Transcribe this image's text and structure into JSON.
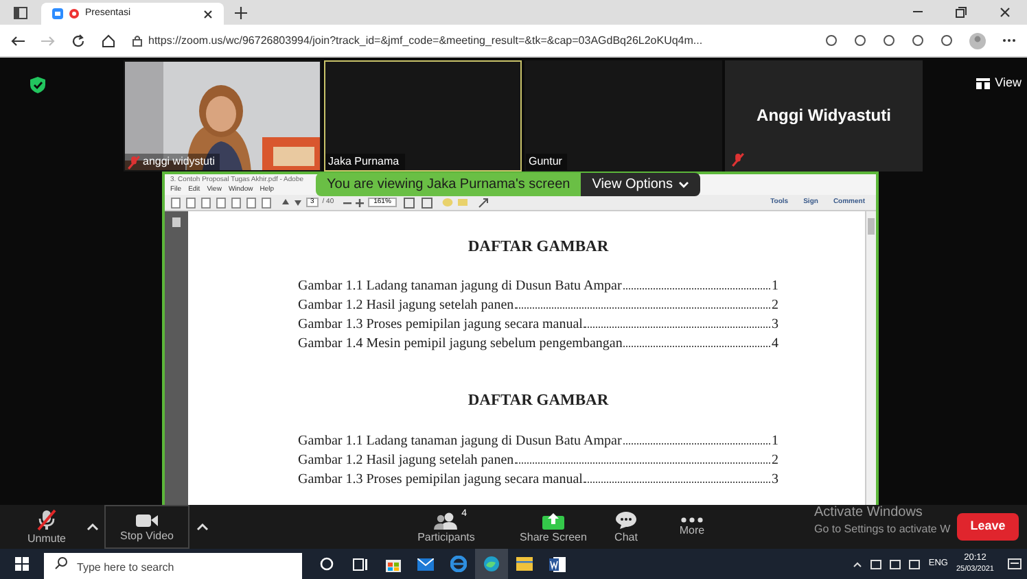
{
  "browser": {
    "tabs": [
      {
        "title": "Presentasi",
        "selected": true
      }
    ],
    "url": "https://zoom.us/wc/96726803994/join?track_id=&jmf_code=&meeting_result=&tk=&cap=03AGdBq26L2oKUq4m..."
  },
  "video_strip": {
    "tiles": [
      {
        "kind": "video",
        "name": "anggi widystuti",
        "muted": true,
        "active_speaker": false
      },
      {
        "kind": "blank",
        "name": "Jaka Purnama",
        "muted": false,
        "active_speaker": true
      },
      {
        "kind": "blank",
        "name": "Guntur",
        "muted": false,
        "active_speaker": false
      },
      {
        "kind": "name_card",
        "name": "Anggi Widyastuti",
        "muted": true,
        "active_speaker": false
      }
    ],
    "view_button": "View"
  },
  "share": {
    "banner": "You are viewing Jaka Purnama's screen",
    "view_options": "View Options",
    "reader": {
      "title": "3. Contoh Proposal Tugas Akhir.pdf - Adobe",
      "menu": [
        "File",
        "Edit",
        "View",
        "Window",
        "Help"
      ],
      "page_number": "3",
      "page_count": "/ 40",
      "zoom": "161%",
      "tool_links": [
        "Tools",
        "Sign",
        "Comment"
      ],
      "sections": [
        {
          "heading": "DAFTAR GAMBAR",
          "entries": [
            {
              "text": "Gambar 1.1 Ladang tanaman jagung di Dusun Batu Ampar",
              "page": "1"
            },
            {
              "text": "Gambar 1.2 Hasil jagung setelah panen",
              "page": "2"
            },
            {
              "text": "Gambar 1.3 Proses pemipilan jagung secara manual",
              "page": "3"
            },
            {
              "text": "Gambar 1.4 Mesin pemipil jagung sebelum pengembangan",
              "page": "4"
            }
          ]
        },
        {
          "heading": "DAFTAR GAMBAR",
          "entries": [
            {
              "text": "Gambar 1.1 Ladang tanaman jagung di Dusun Batu Ampar",
              "page": "1"
            },
            {
              "text": "Gambar 1.2 Hasil jagung setelah panen",
              "page": "2"
            },
            {
              "text": "Gambar 1.3 Proses pemipilan jagung secara manual",
              "page": "3"
            }
          ]
        }
      ]
    }
  },
  "windows_notice": {
    "title": "Activate Windows",
    "text": "Go to Settings to activate W"
  },
  "controls": {
    "items": [
      {
        "kind": "mic",
        "label": "Unmute",
        "muted": true
      },
      {
        "kind": "video",
        "label": "Stop Video"
      },
      {
        "kind": "participants",
        "label": "Participants",
        "count": "4"
      },
      {
        "kind": "share",
        "label": "Share Screen"
      },
      {
        "kind": "chat",
        "label": "Chat"
      },
      {
        "kind": "more",
        "label": "More"
      }
    ],
    "leave": "Leave"
  },
  "taskbar": {
    "search_placeholder": "Type here to search",
    "language": "ENG",
    "time": "20:12",
    "date": "25/03/2021"
  }
}
